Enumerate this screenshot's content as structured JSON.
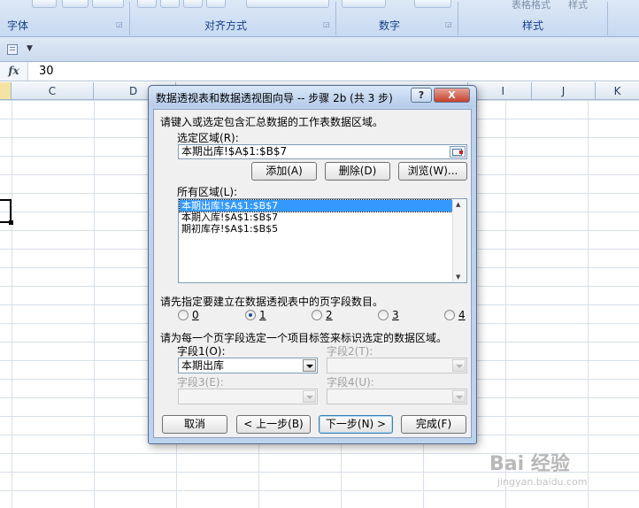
{
  "ribbon": {
    "groups": [
      "字体",
      "对齐方式",
      "数字",
      "样式"
    ],
    "faded_labels": [
      "表格格式",
      "样式"
    ]
  },
  "formula_bar": {
    "fx_label": "fx",
    "value": "30"
  },
  "columns": [
    "C",
    "D",
    "I",
    "J",
    "K"
  ],
  "dialog": {
    "title": "数据透视表和数据透视图向导 -- 步骤 2b (共 3 步)",
    "help_label": "?",
    "close_label": "X",
    "instruction": "请键入或选定包含汇总数据的工作表数据区域。",
    "range_label": "选定区域",
    "range_hotkey": "(R):",
    "range_value": "本期出库!$A$1:$B$7",
    "add_label": "添加(A)",
    "delete_label": "删除(D)",
    "browse_label": "浏览(W)...",
    "all_ranges_label": "所有区域(L):",
    "all_ranges": [
      "本期出库!$A$1:$B$7",
      "本期入库!$A$1:$B$7",
      "期初库存!$A$1:$B$5"
    ],
    "page_field_prompt": "请先指定要建立在数据透视表中的页字段数目。",
    "page_field_options": [
      "0",
      "1",
      "2",
      "3",
      "4"
    ],
    "page_field_selected": "1",
    "label_prompt": "请为每一个页字段选定一个项目标签来标识选定的数据区域。",
    "field1_label": "字段1(O):",
    "field1_value": "本期出库",
    "field2_label": "字段2(T):",
    "field3_label": "字段3(E):",
    "field4_label": "字段4(U):",
    "cancel_label": "取消",
    "back_label": "< 上一步(B)",
    "next_label": "下一步(N) >",
    "finish_label": "完成(F)"
  },
  "watermark": {
    "brand": "Bai 经验",
    "url": "jingyan.baidu.com"
  }
}
